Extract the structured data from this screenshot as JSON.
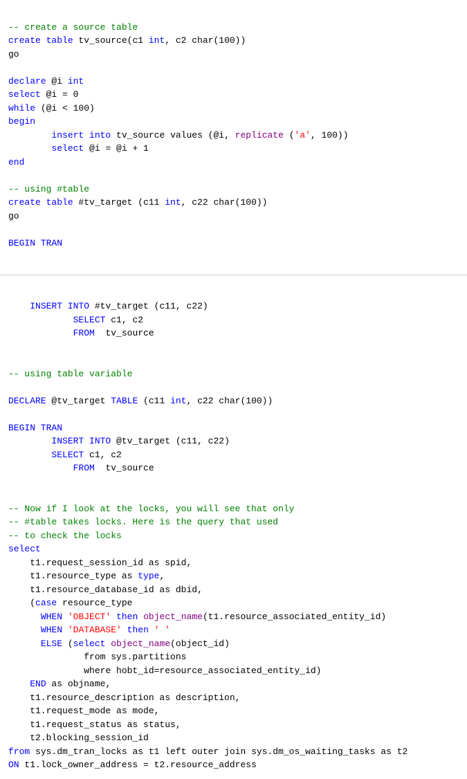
{
  "code": {
    "content": "SQL code block"
  }
}
